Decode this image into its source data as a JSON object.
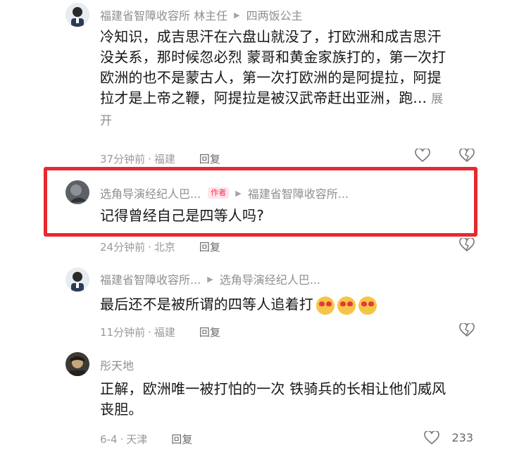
{
  "comments": [
    {
      "author": "福建省智障收容所 林主任",
      "reply_to": "四两饭公主",
      "text": "冷知识，成吉思汗在六盘山就没了，打欧洲和成吉思汗没关系，那时候忽必烈 蒙哥和黄金家族打的，第一次打欧洲的也不是蒙古人，第一次打欧洲的是阿提拉，阿提拉才是上帝之鞭，阿提拉是被汉武帝赶出亚洲，跑...",
      "expand_label": "展开",
      "time": "37分钟前",
      "location": "福建",
      "reply_label": "回复"
    },
    {
      "author": "选角导演经纪人巴...",
      "badge": "作者",
      "reply_to": "福建省智障收容所...",
      "text": "记得曾经自己是四等人吗?",
      "time": "24分钟前",
      "location": "北京",
      "reply_label": "回复"
    },
    {
      "author": "福建省智障收容所...",
      "reply_to": "选角导演经纪人巴...",
      "text": "最后还不是被所谓的四等人追着打",
      "time": "11分钟前",
      "location": "福建",
      "reply_label": "回复"
    },
    {
      "author": "彤天地",
      "text": "正解，欧洲唯一被打怕的一次 铁骑兵的长相让他们威风丧胆。",
      "time": "6-4",
      "location": "天津",
      "reply_label": "回复",
      "like_count": "233"
    }
  ],
  "separator": "·",
  "colors": {
    "highlight": "#e82830",
    "author_badge": "#fe2c55"
  }
}
